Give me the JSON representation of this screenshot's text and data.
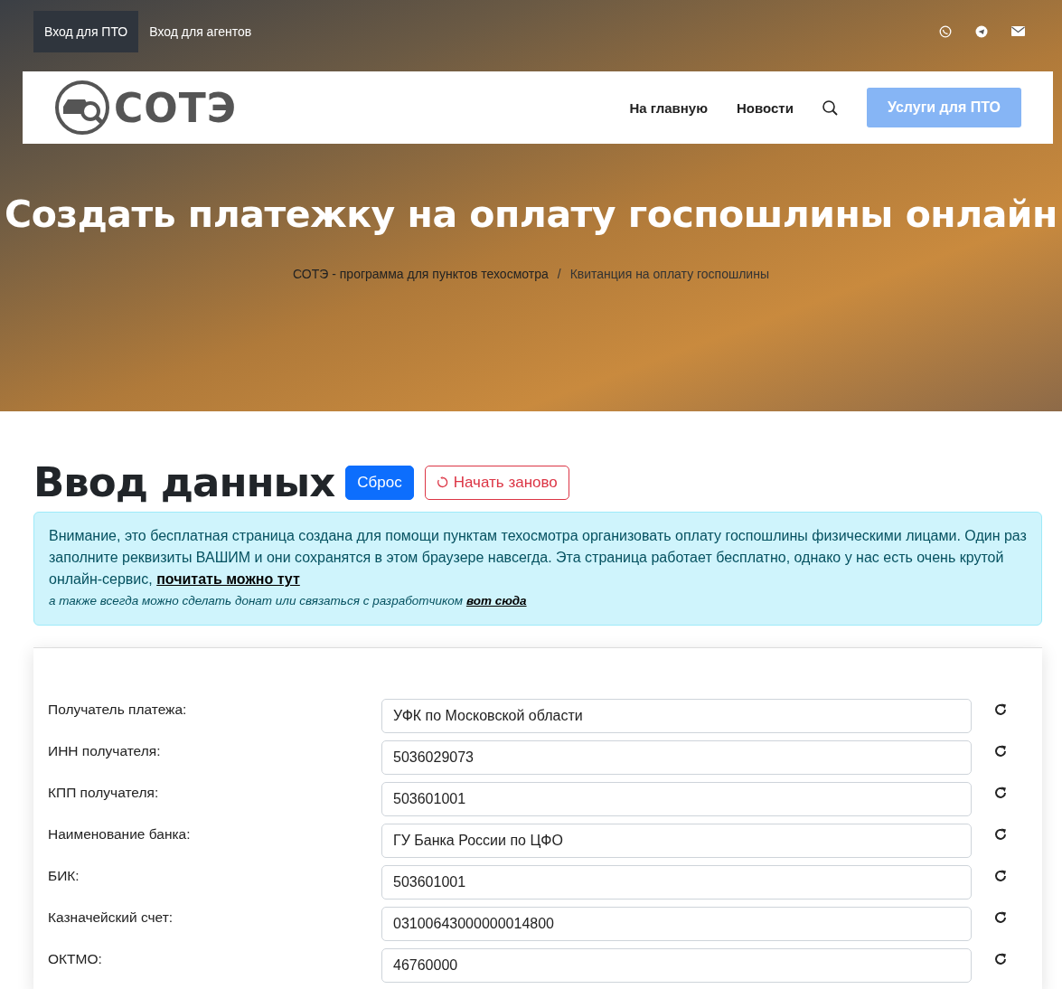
{
  "topbar": {
    "links": [
      {
        "label": "Вход для ПТО",
        "selected": true
      },
      {
        "label": "Вход для агентов",
        "selected": false
      }
    ]
  },
  "header": {
    "logo_text": "СОТЭ",
    "nav": [
      "На главную",
      "Новости"
    ],
    "cta": "Услуги для ПТО"
  },
  "hero": {
    "title": "Создать платежку на оплату госпошлины онлайн",
    "breadcrumbs": [
      "СОТЭ - программа для пунктов техосмотра",
      "Квитанция на оплату госпошлины"
    ],
    "separator": "/"
  },
  "section": {
    "heading": "Ввод данных",
    "buttons": [
      {
        "label": "Сброс",
        "kind": "primary"
      },
      {
        "label": "Начать заново",
        "kind": "outline-danger"
      }
    ]
  },
  "notice": {
    "text": "Внимание, это бесплатная страница создана для помощи пунктам техосмотра организовать оплату госпошлины физическими лицами. Один раз заполните реквизиты ВАШИМ и они сохранятся в этом браузере навсегда. Эта страница работает бесплатно, однако у нас есть очень крутой онлайн-сервис,",
    "link": "почитать можно тут",
    "note": "а также всегда можно сделать донат или связаться с разработчиком",
    "note_link": "вот сюда"
  },
  "form": {
    "fields": [
      {
        "label": "Получатель платежа:",
        "value": "УФК по Московской области"
      },
      {
        "label": "ИНН получателя:",
        "value": "5036029073"
      },
      {
        "label": "КПП получателя:",
        "value": "503601001"
      },
      {
        "label": "Наименование банка:",
        "value": "ГУ Банка России по ЦФО"
      },
      {
        "label": "БИК:",
        "value": "503601001"
      },
      {
        "label": "Казначейский счет:",
        "value": "03100643000000014800"
      },
      {
        "label": "ОКТМО:",
        "value": "46760000"
      }
    ]
  }
}
